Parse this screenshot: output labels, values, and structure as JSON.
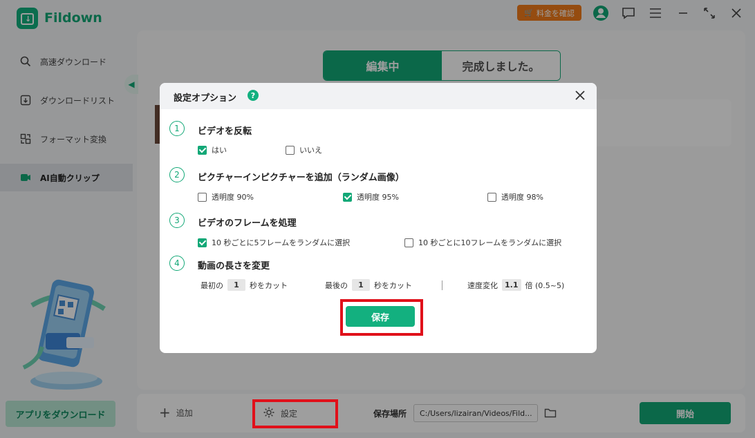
{
  "app": {
    "name": "Fildown",
    "price_button": "料金を確認"
  },
  "sidebar": {
    "items": [
      {
        "label": "高速ダウンロード",
        "icon": "search-icon"
      },
      {
        "label": "ダウンロードリスト",
        "icon": "download-list-icon"
      },
      {
        "label": "フォーマット変換",
        "icon": "convert-icon"
      },
      {
        "label": "AI自動クリップ",
        "icon": "ai-clip-icon",
        "active": true
      }
    ],
    "download_app_button": "アプリをダウンロード"
  },
  "main": {
    "tabs": [
      {
        "label": "編集中",
        "active": true
      },
      {
        "label": "完成しました。",
        "active": false
      }
    ]
  },
  "bottom": {
    "add_label": "追加",
    "settings_label": "設定",
    "save_location_label": "保存場所",
    "save_path": "C:/Users/lizairan/Videos/Fild...",
    "start_label": "開始"
  },
  "dialog": {
    "title": "設定オプション",
    "help": "?",
    "sections": [
      {
        "num": "1",
        "title": "ビデオを反転",
        "options": [
          {
            "label": "はい",
            "checked": true
          },
          {
            "label": "いいえ",
            "checked": false
          }
        ]
      },
      {
        "num": "2",
        "title": "ピクチャーインピクチャーを追加（ランダム画像）",
        "options": [
          {
            "label": "透明度 90%",
            "checked": false
          },
          {
            "label": "透明度 95%",
            "checked": true
          },
          {
            "label": "透明度 98%",
            "checked": false
          }
        ]
      },
      {
        "num": "3",
        "title": "ビデオのフレームを処理",
        "options": [
          {
            "label": "10 秒ごとに5フレームをランダムに選択",
            "checked": true
          },
          {
            "label": "10 秒ごとに10フレームをランダムに選択",
            "checked": false
          }
        ]
      },
      {
        "num": "4",
        "title": "動画の長さを変更",
        "length": {
          "first_prefix": "最初の",
          "first_value": "1",
          "first_suffix": "秒をカット",
          "last_prefix": "最後の",
          "last_value": "1",
          "last_suffix": "秒をカット",
          "speed_prefix": "速度変化",
          "speed_value": "1.1",
          "speed_suffix": "倍 (0.5~5)"
        }
      }
    ],
    "save_label": "保存"
  },
  "colors": {
    "accent": "#13a877",
    "highlight": "#e0101a",
    "price": "#f07b1a"
  }
}
